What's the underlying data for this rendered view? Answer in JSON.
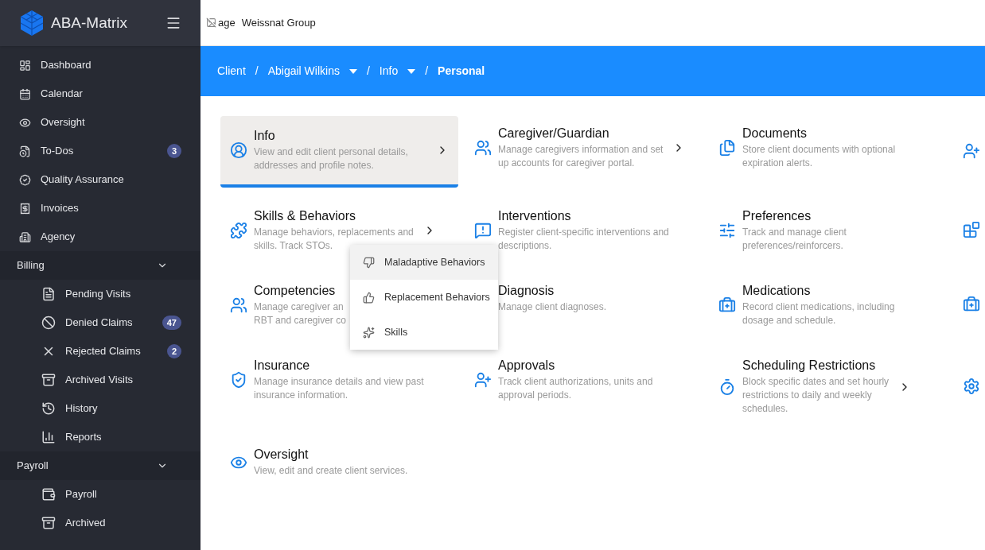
{
  "brand": {
    "name": "ABA-Matrix"
  },
  "sidebar": {
    "items": [
      {
        "label": "Dashboard"
      },
      {
        "label": "Calendar"
      },
      {
        "label": "Oversight"
      },
      {
        "label": "To-Dos",
        "badge": "3"
      },
      {
        "label": "Quality Assurance"
      },
      {
        "label": "Invoices"
      },
      {
        "label": "Agency"
      }
    ],
    "sections": [
      {
        "label": "Billing",
        "expanded": true,
        "items": [
          {
            "label": "Pending Visits"
          },
          {
            "label": "Denied Claims",
            "badge": "47"
          },
          {
            "label": "Rejected Claims",
            "badge": "2"
          },
          {
            "label": "Archived Visits"
          },
          {
            "label": "History"
          },
          {
            "label": "Reports"
          }
        ]
      },
      {
        "label": "Payroll",
        "expanded": true,
        "items": [
          {
            "label": "Payroll"
          },
          {
            "label": "Archived"
          }
        ]
      }
    ]
  },
  "topbar": {
    "broken_image_alt": "age",
    "organization": "Weissnat Group"
  },
  "breadcrumb": [
    {
      "label": "Client",
      "dropdown": false,
      "current": false
    },
    {
      "separator": "/",
      "label": "Abigail Wilkins",
      "dropdown": true,
      "current": false
    },
    {
      "separator": "/",
      "label": "Info",
      "dropdown": true,
      "current": false
    },
    {
      "separator": "/",
      "label": "Personal",
      "dropdown": false,
      "current": true
    }
  ],
  "cards": [
    {
      "title": "Info",
      "description": [
        "View and edit client personal details,",
        "addresses and profile notes."
      ],
      "chevron": true,
      "selected": true
    },
    {
      "title": "Caregiver/Guardian",
      "description": [
        "Manage caregivers information and set",
        "up accounts for caregiver portal."
      ],
      "chevron": true,
      "selected": false
    },
    {
      "title": "Documents",
      "description": [
        "Store client documents with optional",
        "expiration alerts."
      ],
      "chevron": false,
      "selected": false
    },
    {
      "title": "Skills & Behaviors",
      "description": [
        "Manage behaviors, replacements and",
        "skills. Track STOs."
      ],
      "chevron": true,
      "selected": false
    },
    {
      "title": "Interventions",
      "description": [
        "Register client-specific interventions and",
        "descriptions."
      ],
      "chevron": false,
      "selected": false
    },
    {
      "title": "Preferences",
      "description": [
        "Track and manage client",
        "preferences/reinforcers."
      ],
      "chevron": false,
      "selected": false
    },
    {
      "title": "Competencies",
      "description": [
        "Manage caregiver an",
        "RBT and caregiver co"
      ],
      "chevron": false,
      "selected": false
    },
    {
      "title": "Diagnosis",
      "description": [
        "Manage client diagnoses."
      ],
      "chevron": false,
      "selected": false
    },
    {
      "title": "Medications",
      "description": [
        "Record client medications, including",
        "dosage and schedule."
      ],
      "chevron": false,
      "selected": false
    },
    {
      "title": "Insurance",
      "description": [
        "Manage insurance details and view past",
        "insurance information."
      ],
      "chevron": false,
      "selected": false
    },
    {
      "title": "Approvals",
      "description": [
        "Track client authorizations, units and",
        "approval periods."
      ],
      "chevron": false,
      "selected": false
    },
    {
      "title": "Scheduling Restrictions",
      "description": [
        "Block specific dates and set hourly",
        "restrictions to daily and weekly",
        "schedules."
      ],
      "chevron": true,
      "selected": false
    },
    {
      "title": "Oversight",
      "description": [
        "View, edit and create client services."
      ],
      "chevron": false,
      "selected": false
    }
  ],
  "submenu": [
    {
      "label": "Maladaptive Behaviors",
      "selected": true
    },
    {
      "label": "Replacement Behaviors",
      "selected": false
    },
    {
      "label": "Skills",
      "selected": false
    }
  ]
}
